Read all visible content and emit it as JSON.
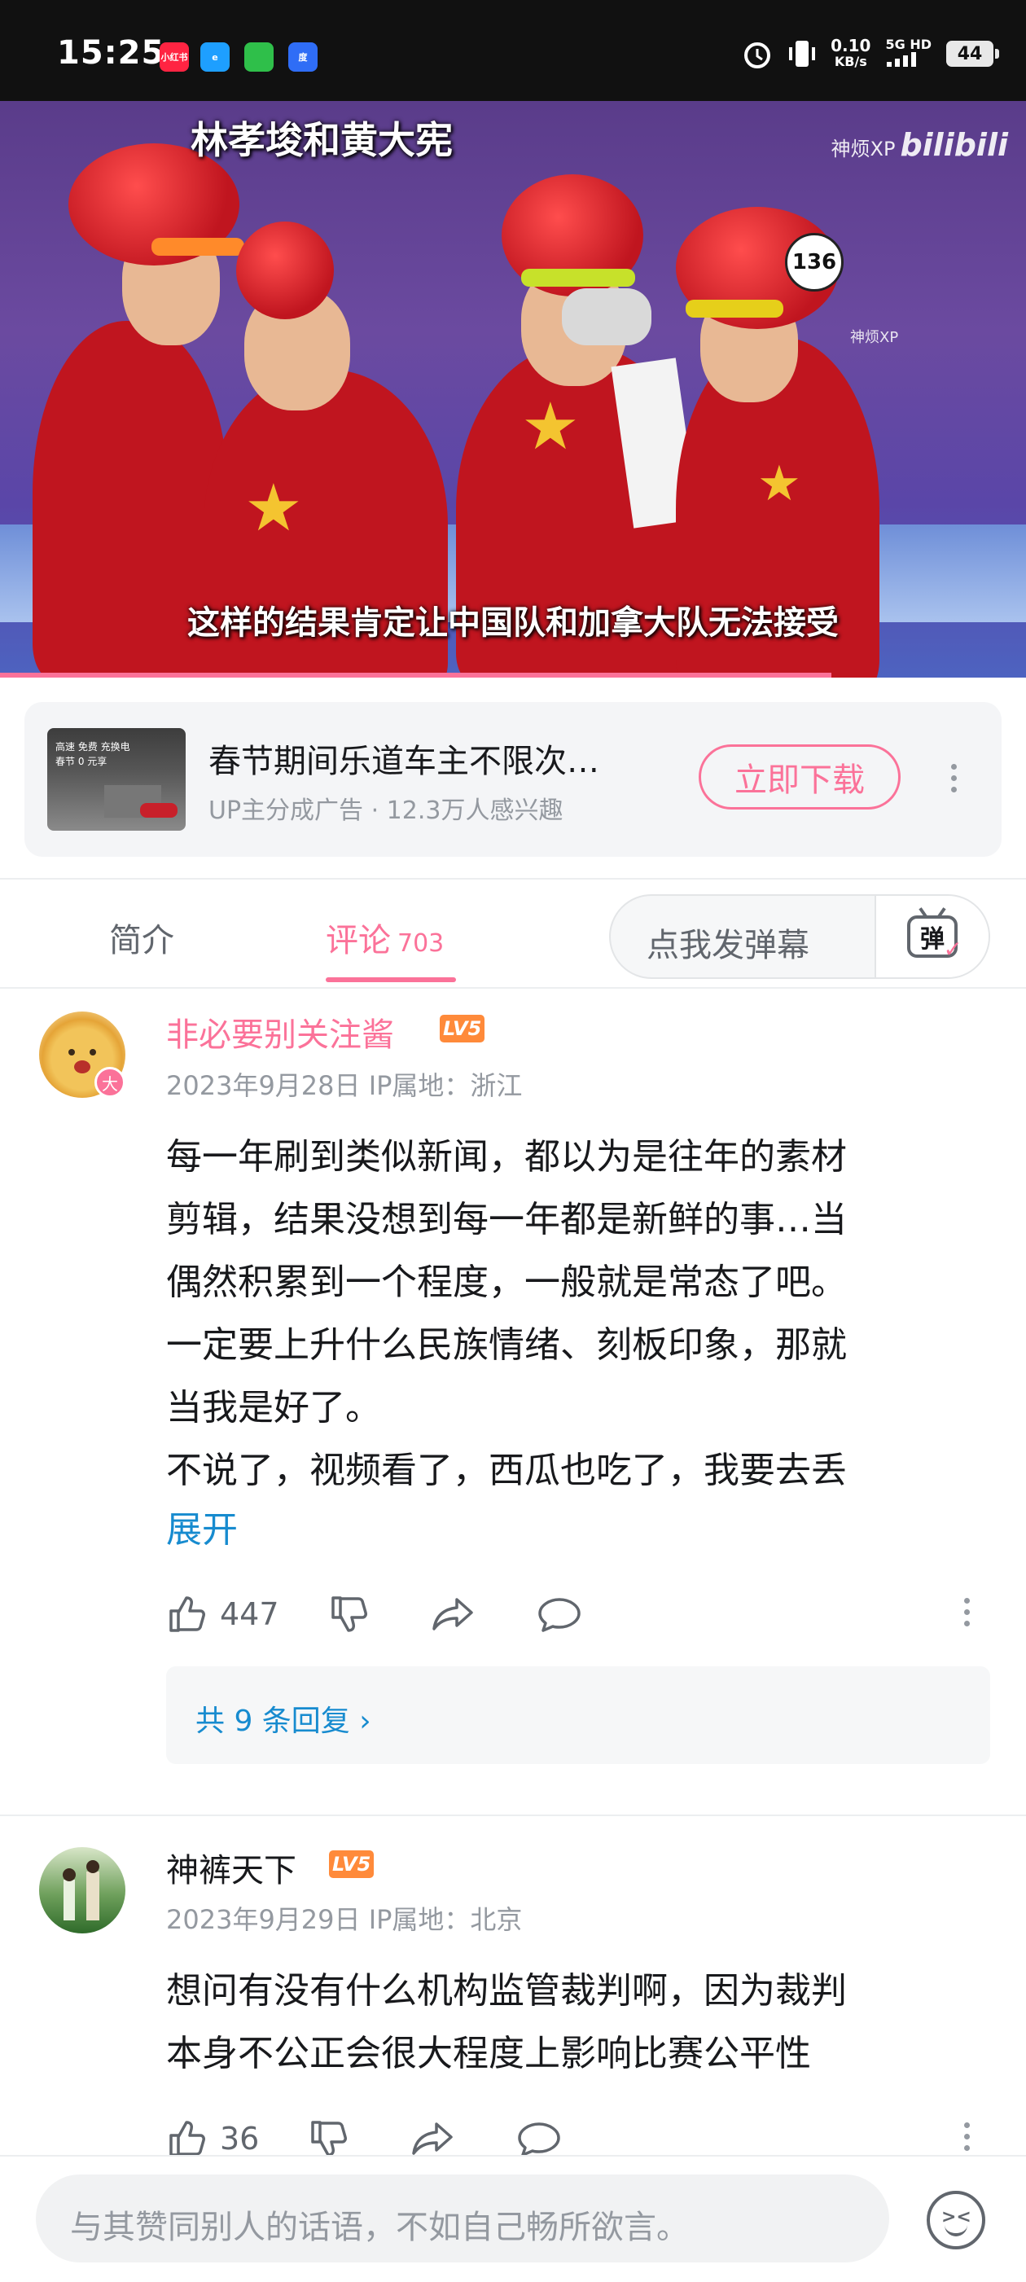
{
  "status_bar": {
    "time": "15:25",
    "apps": [
      "小红书",
      "e",
      "",
      "度"
    ],
    "speed_value": "0.10",
    "speed_unit": "KB/s",
    "network": "5G HD",
    "battery": "44"
  },
  "video": {
    "title_overlay": "林孝埈和黄大宪",
    "subtitle": "这样的结果肯定让中国队和加拿大队无法接受",
    "watermark_channel": "神烦XP",
    "watermark_brand": "bilibili",
    "watermark_small": "神烦XP",
    "helmet_number": "136",
    "progress_fraction": 0.81
  },
  "ad": {
    "thumb_text": "高速 免费 充换电\n春节 0 元享",
    "title": "春节期间乐道车主不限次…",
    "meta": "UP主分成广告 · 12.3万人感兴趣",
    "button": "立即下载"
  },
  "tabs": {
    "intro": "简介",
    "comments": "评论",
    "comments_count": "703",
    "danmaku_placeholder": "点我发弹幕",
    "danmaku_icon_char": "弹"
  },
  "comments": [
    {
      "username": "非必要别关注酱",
      "level": "LV5",
      "badge": "大",
      "meta": "2023年9月28日 IP属地：浙江",
      "body": "每一年刷到类似新闻，都以为是往年的素材\n剪辑，结果没想到每一年都是新鲜的事…当\n偶然积累到一个程度，一般就是常态了吧。\n一定要上升什么民族情绪、刻板印象，那就\n当我是好了。\n不说了，视频看了，西瓜也吃了，我要去丢",
      "expand": "展开",
      "likes": "447",
      "replies": "共 9 条回复 ›"
    },
    {
      "username": "神裤天下",
      "level": "LV5",
      "meta": "2023年9月29日 IP属地：北京",
      "body": "想问有没有什么机构监管裁判啊，因为裁判\n本身不公正会很大程度上影响比赛公平性",
      "likes": "36"
    }
  ],
  "bottom_bar": {
    "placeholder": "与其赞同别人的话语，不如自己畅所欲言。"
  },
  "colors": {
    "accent_pink": "#fb7299",
    "link_blue": "#178bcf",
    "level_orange": "#ff8a3a",
    "muted_gray": "#9499a0"
  }
}
